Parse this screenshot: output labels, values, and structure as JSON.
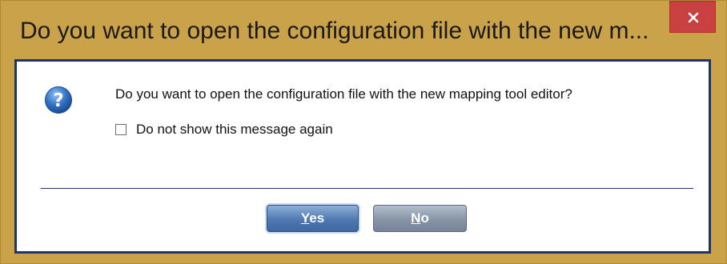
{
  "window": {
    "title": "Do you want to open the configuration file with the new m...",
    "close_glyph": "×"
  },
  "dialog": {
    "icon": "question-icon",
    "message": "Do you want to open the configuration file with the new mapping tool editor?",
    "checkbox": {
      "label": "Do not show this message again",
      "checked": false
    },
    "buttons": {
      "yes": {
        "mnemonic": "Y",
        "rest": "es"
      },
      "no": {
        "mnemonic": "N",
        "rest": "o"
      }
    }
  },
  "colors": {
    "frame": "#c9a24a",
    "close": "#c8403f",
    "border": "#1f3566",
    "icon_blue": "#2f6fc0"
  }
}
